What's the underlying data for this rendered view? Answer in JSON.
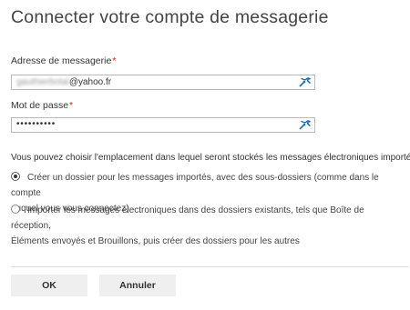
{
  "dialog": {
    "title": "Connecter votre compte de messagerie"
  },
  "email": {
    "label": "Adresse de messagerie",
    "required_mark": "*",
    "value_obscured": "gauthierbotal",
    "value_domain": "@yahoo.fr"
  },
  "password": {
    "label": "Mot de passe",
    "required_mark": "*",
    "value_masked": "••••••••••"
  },
  "import": {
    "description": "Vous pouvez choisir l'emplacement dans lequel seront stockés les messages électroniques importés.",
    "options": [
      {
        "line1": "Créer un dossier pour les messages importés, avec des sous-dossiers (comme dans le compte",
        "line2": "auquel vous vous connectez)",
        "selected": true
      },
      {
        "line1": "Importer les messages électroniques dans des dossiers existants, tels que Boîte de réception,",
        "line2": "Éléments envoyés et Brouillons, puis créer des dossiers pour les autres",
        "selected": false
      }
    ]
  },
  "buttons": {
    "ok": "OK",
    "cancel": "Annuler"
  },
  "colors": {
    "required": "#e81123",
    "key_icon": "#1e6fb8"
  },
  "icons": {
    "field_icon": "key-icon"
  }
}
